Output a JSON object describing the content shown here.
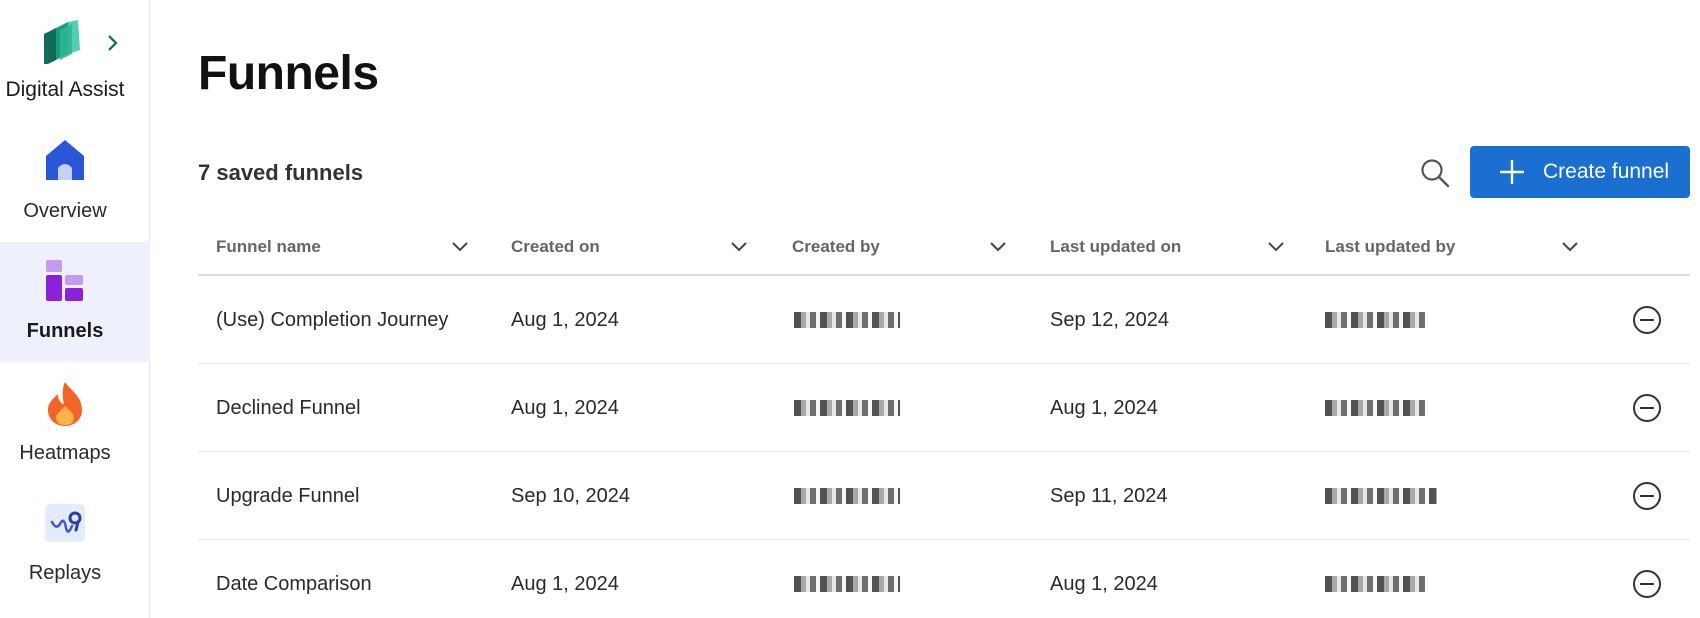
{
  "sidebar": {
    "brand_label": "Digital Assist",
    "items": [
      {
        "label": "Overview",
        "icon": "home-icon",
        "active": false
      },
      {
        "label": "Funnels",
        "icon": "funnel-chart-icon",
        "active": true
      },
      {
        "label": "Heatmaps",
        "icon": "flame-icon",
        "active": false
      },
      {
        "label": "Replays",
        "icon": "replay-path-icon",
        "active": false
      }
    ]
  },
  "header": {
    "title": "Funnels",
    "count_label": "7 saved funnels",
    "create_label": "Create funnel"
  },
  "table": {
    "columns": [
      "Funnel name",
      "Created on",
      "Created by",
      "Last updated on",
      "Last updated by"
    ],
    "rows": [
      {
        "name": "(Use) Completion Journey",
        "created_on": "Aug 1, 2024",
        "updated_on": "Sep 12, 2024"
      },
      {
        "name": "Declined Funnel",
        "created_on": "Aug 1, 2024",
        "updated_on": "Aug 1, 2024"
      },
      {
        "name": "Upgrade Funnel",
        "created_on": "Sep 10, 2024",
        "updated_on": "Sep 11, 2024"
      },
      {
        "name": "Date Comparison",
        "created_on": "Aug 1, 2024",
        "updated_on": "Aug 1, 2024"
      }
    ]
  },
  "colors": {
    "accent": "#1a6fd1",
    "active_nav_bg": "#eef1fb"
  }
}
